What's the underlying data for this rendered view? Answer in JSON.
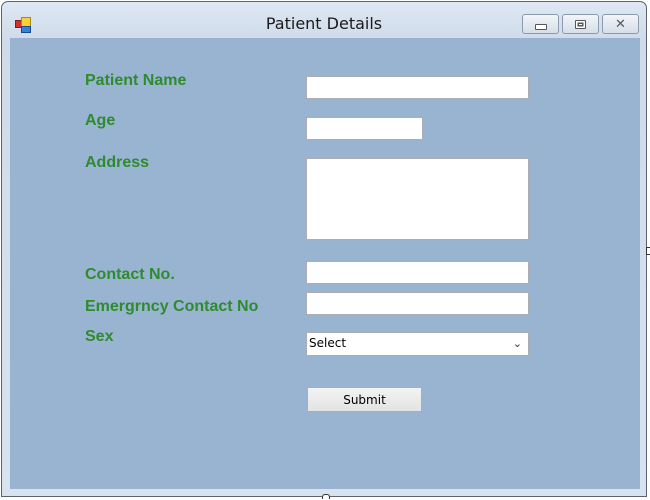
{
  "window": {
    "title": "Patient Details",
    "controls": {
      "minimize": "minimize",
      "maximize": "maximize",
      "close": "close"
    }
  },
  "form": {
    "labels": {
      "patient_name": "Patient Name",
      "age": "Age",
      "address": "Address",
      "contact_no": "Contact No.",
      "emergency_contact_no": "Emergrncy Contact No",
      "sex": "Sex"
    },
    "values": {
      "patient_name": "",
      "age": "",
      "address": "",
      "contact_no": "",
      "emergency_contact_no": ""
    },
    "sex_select": {
      "selected": "Select"
    },
    "submit_label": "Submit"
  },
  "colors": {
    "client_background": "#99b4d1",
    "label_color": "#2e8b2e"
  }
}
